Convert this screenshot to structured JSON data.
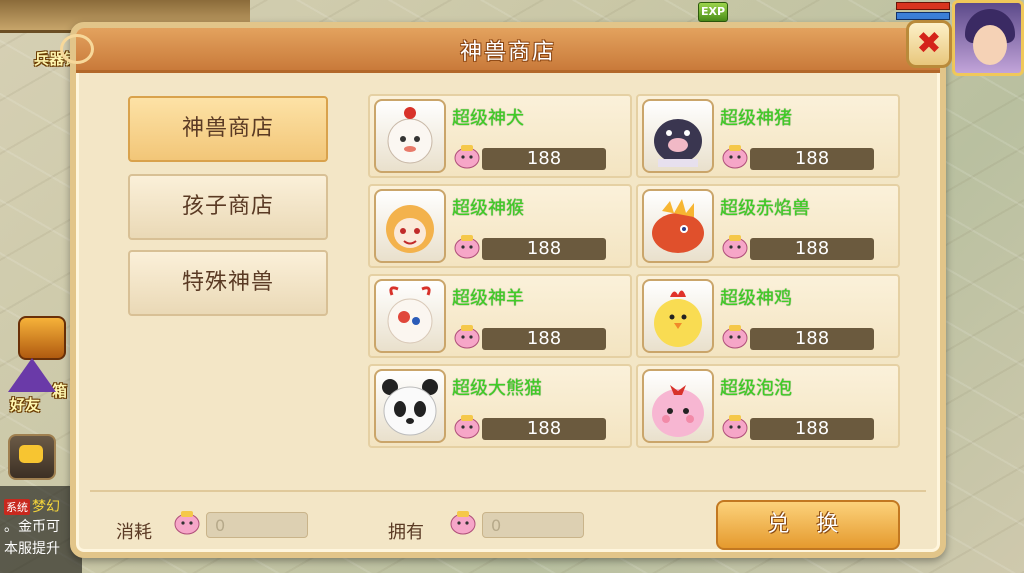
{
  "world": {
    "building_label": "兵器铺",
    "exp_label": "EXP",
    "friend_label": "好友",
    "chest_label": "箱",
    "chat": {
      "line1_tag": "系统",
      "line1_text": "梦幻",
      "line2": "。金币可",
      "line3": "本服提升"
    }
  },
  "dialog": {
    "title": "神兽商店",
    "close_icon": "close-x",
    "tabs": [
      {
        "label": "神兽商店",
        "active": true
      },
      {
        "label": "孩子商店",
        "active": false
      },
      {
        "label": "特殊神兽",
        "active": false
      }
    ],
    "items": [
      {
        "name": "超级神犬",
        "price": "188",
        "icon": "white-lion-dog"
      },
      {
        "name": "超级神猪",
        "price": "188",
        "icon": "black-pig"
      },
      {
        "name": "超级神猴",
        "price": "188",
        "icon": "monkey"
      },
      {
        "name": "超级赤焰兽",
        "price": "188",
        "icon": "red-flame-beast"
      },
      {
        "name": "超级神羊",
        "price": "188",
        "icon": "sheep"
      },
      {
        "name": "超级神鸡",
        "price": "188",
        "icon": "chicken"
      },
      {
        "name": "超级大熊猫",
        "price": "188",
        "icon": "panda"
      },
      {
        "name": "超级泡泡",
        "price": "188",
        "icon": "pink-bubble"
      }
    ],
    "footer": {
      "cost_label": "消耗",
      "cost_value": "0",
      "own_label": "拥有",
      "own_value": "0",
      "exchange_label": "兑 换"
    },
    "colors": {
      "item_name": "#3ecf25",
      "price_bar": "#6b5a3e",
      "title_bar": "#d88b46"
    }
  }
}
